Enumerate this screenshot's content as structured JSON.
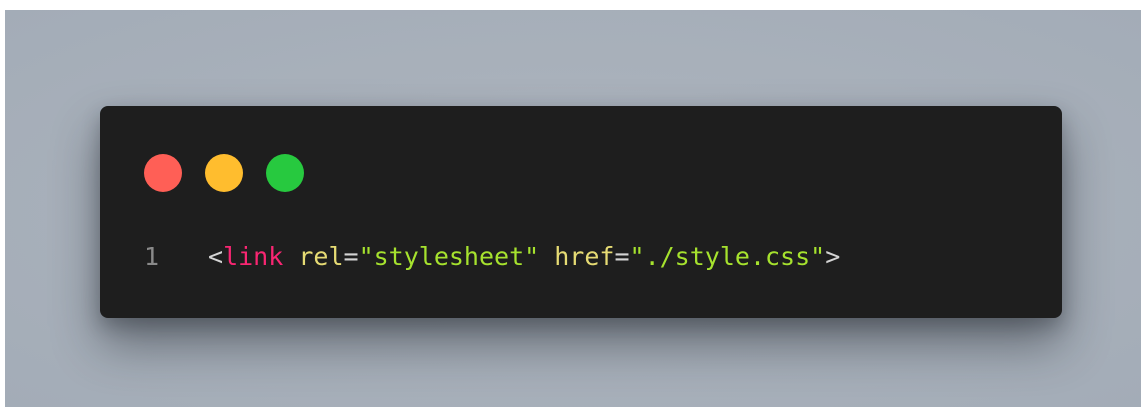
{
  "window": {
    "controls": [
      {
        "name": "close",
        "color": "#ff5f56"
      },
      {
        "name": "minimize",
        "color": "#ffbd2e"
      },
      {
        "name": "maximize",
        "color": "#27c93f"
      }
    ]
  },
  "code": {
    "line_number": "1",
    "tokens": {
      "open_bracket": "<",
      "tag": "link",
      "space1": " ",
      "attr1": "rel",
      "eq1": "=",
      "val1": "\"stylesheet\"",
      "space2": " ",
      "attr2": "href",
      "eq2": "=",
      "val2": "\"./style.css\"",
      "close_bracket": ">"
    },
    "colors": {
      "punctuation": "#d4d4d4",
      "tag": "#f92672",
      "attribute": "#e6db74",
      "value": "#a6e22e",
      "line_number": "#8a8a8a",
      "background": "#1e1e1e"
    }
  }
}
